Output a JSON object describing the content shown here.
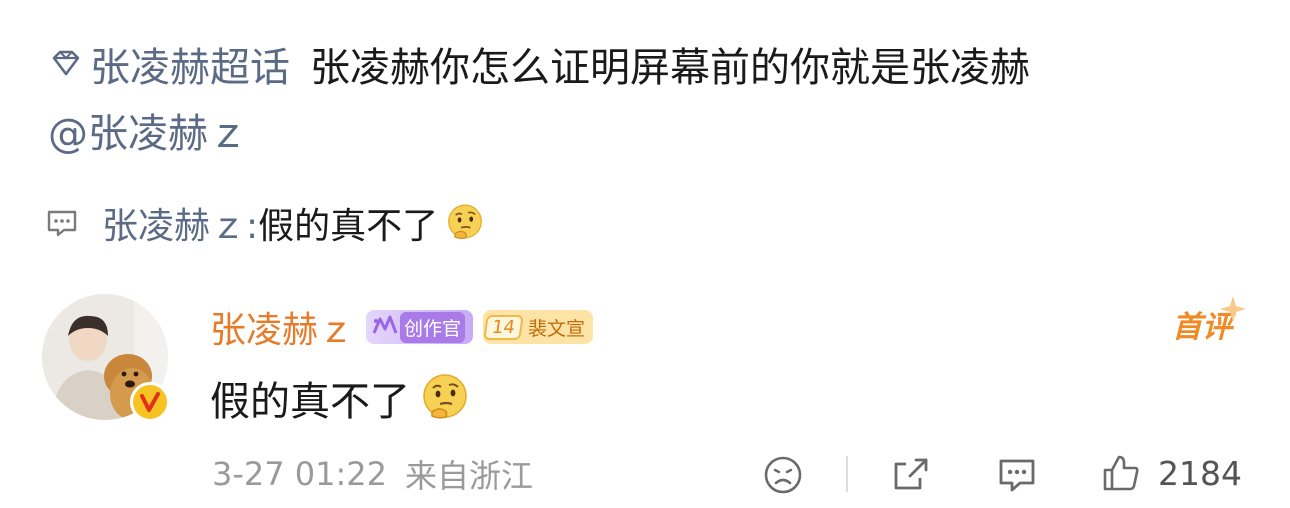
{
  "post": {
    "topic": "张凌赫超话",
    "topic_icon": "diamond-icon",
    "text": "张凌赫你怎么证明屏幕前的你就是张凌赫",
    "mention": "@张凌赫ｚ"
  },
  "preview": {
    "author": "张凌赫ｚ:",
    "text": "假的真不了",
    "emoji": "thinking-face-emoji"
  },
  "comment": {
    "author": "张凌赫ｚ",
    "creator_badge": "创作官",
    "fan_level": "14",
    "fan_badge": "裴文宣",
    "first_tag": "首评",
    "text": "假的真不了",
    "emoji": "thinking-face-emoji",
    "date": "3-27 01:22",
    "location": "来自浙江",
    "likes": "2184"
  },
  "colors": {
    "link": "#5b6b86",
    "author": "#e77b28",
    "meta": "#9a9a9a"
  }
}
